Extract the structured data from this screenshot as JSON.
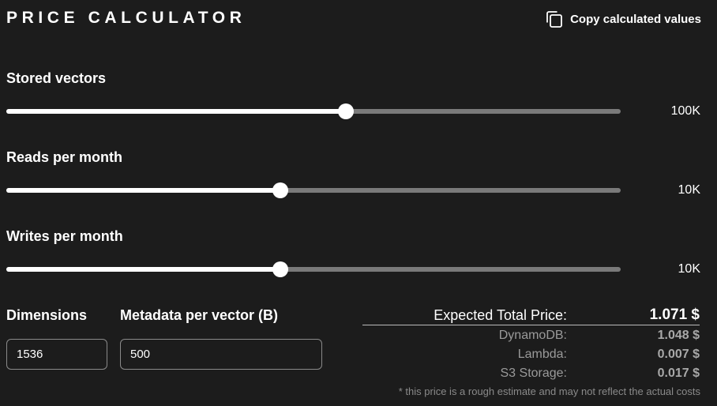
{
  "header": {
    "title": "PRICE CALCULATOR",
    "copy_label": "Copy calculated values",
    "copy_icon": "copy-icon"
  },
  "sliders": [
    {
      "label": "Stored vectors",
      "value": "100K",
      "fraction": 0.553
    },
    {
      "label": "Reads per month",
      "value": "10K",
      "fraction": 0.446
    },
    {
      "label": "Writes per month",
      "value": "10K",
      "fraction": 0.446
    }
  ],
  "inputs": {
    "dimensions": {
      "label": "Dimensions",
      "value": "1536"
    },
    "metadata": {
      "label": "Metadata per vector (B)",
      "value": "500"
    }
  },
  "pricing": {
    "total_label": "Expected Total Price:",
    "total_value": "1.071 $",
    "breakdown": [
      {
        "label": "DynamoDB:",
        "value": "1.048 $"
      },
      {
        "label": "Lambda:",
        "value": "0.007 $"
      },
      {
        "label": "S3 Storage:",
        "value": "0.017 $"
      }
    ],
    "disclaimer": "* this price is a rough estimate and may not reflect the actual costs"
  },
  "colors": {
    "background": "#1c1c1c",
    "track_filled": "#ffffff",
    "track_empty": "#7a7a7a"
  }
}
